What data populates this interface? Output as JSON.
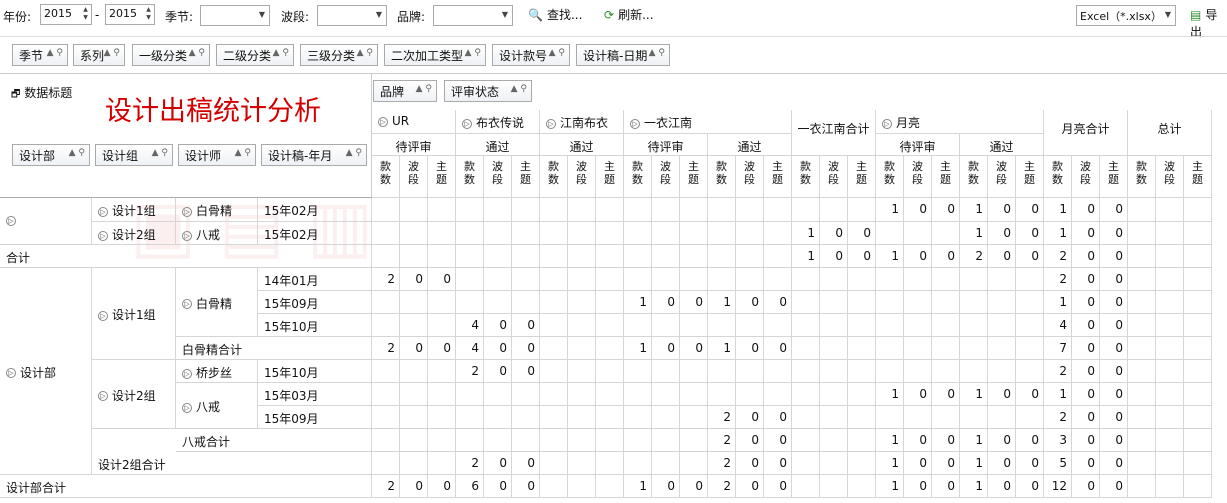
{
  "toolbar": {
    "year_label": "年份:",
    "year_from": "2015",
    "dash": "-",
    "year_to": "2015",
    "season_label": "季节:",
    "band_label": "波段:",
    "brand_label": "品牌:",
    "find_label": "查找...",
    "refresh_label": "刷新...",
    "export_format": "Excel（*.xlsx）",
    "export_label": "导出"
  },
  "fields": [
    "季节",
    "系列",
    "一级分类",
    "二级分类",
    "三级分类",
    "二次加工类型",
    "设计款号",
    "设计稿-日期"
  ],
  "data_title_label": "数据标题",
  "report_title": "设计出稿统计分析",
  "col_fields": [
    "品牌",
    "评审状态"
  ],
  "row_fields": [
    "设计部",
    "设计组",
    "设计师",
    "设计稿-年月"
  ],
  "brands": [
    "UR",
    "布衣传说",
    "江南布衣",
    "一衣江南",
    "一衣江南合计",
    "月亮",
    "月亮合计",
    "总计"
  ],
  "statuses": [
    "待评审",
    "通过",
    "通过",
    "待评审",
    "通过",
    "待评审",
    "通过"
  ],
  "metric": [
    "款数",
    "波段",
    "主题"
  ],
  "rows": [
    {
      "c0": "",
      "c1": "设计1组",
      "c2": "白骨精",
      "c3": "15年02月",
      "v": {
        "18": "1",
        "19": "0",
        "20": "0",
        "21": "1",
        "22": "0",
        "23": "0",
        "24": "1",
        "25": "0",
        "26": "0"
      }
    },
    {
      "c0": "",
      "c1": "设计2组",
      "c2": "八戒",
      "c3": "15年02月",
      "v": {
        "15": "1",
        "16": "0",
        "17": "0",
        "21": "1",
        "22": "0",
        "23": "0",
        "24": "1",
        "25": "0",
        "26": "0"
      }
    },
    {
      "c0": "合计",
      "v": {
        "15": "1",
        "16": "0",
        "17": "0",
        "18": "1",
        "19": "0",
        "20": "0",
        "21": "2",
        "22": "0",
        "23": "0",
        "24": "2",
        "25": "0",
        "26": "0"
      }
    },
    {
      "c3": "14年01月",
      "v": {
        "0": "2",
        "1": "0",
        "2": "0",
        "24": "2",
        "25": "0",
        "26": "0"
      }
    },
    {
      "c3": "15年09月",
      "v": {
        "9": "1",
        "10": "0",
        "11": "0",
        "12": "1",
        "13": "0",
        "14": "0",
        "24": "1",
        "25": "0",
        "26": "0"
      }
    },
    {
      "c3": "15年10月",
      "v": {
        "3": "4",
        "4": "0",
        "5": "0",
        "24": "4",
        "25": "0",
        "26": "0"
      }
    },
    {
      "c2": "白骨精合计",
      "v": {
        "0": "2",
        "1": "0",
        "2": "0",
        "3": "4",
        "4": "0",
        "5": "0",
        "9": "1",
        "10": "0",
        "11": "0",
        "12": "1",
        "13": "0",
        "14": "0",
        "24": "7",
        "25": "0",
        "26": "0"
      }
    },
    {
      "c2": "桥步丝",
      "c3": "15年10月",
      "v": {
        "3": "2",
        "4": "0",
        "5": "0",
        "24": "2",
        "25": "0",
        "26": "0"
      }
    },
    {
      "c3": "15年03月",
      "v": {
        "18": "1",
        "19": "0",
        "20": "0",
        "21": "1",
        "22": "0",
        "23": "0",
        "24": "1",
        "25": "0",
        "26": "0"
      }
    },
    {
      "c3": "15年09月",
      "v": {
        "12": "2",
        "13": "0",
        "14": "0",
        "24": "2",
        "25": "0",
        "26": "0",
        "r": "2"
      }
    },
    {
      "c2": "八戒合计",
      "v": {
        "12": "2",
        "13": "0",
        "14": "0",
        "18": "1",
        "19": "0",
        "20": "0",
        "21": "1",
        "22": "0",
        "23": "0",
        "24": "3",
        "25": "0",
        "26": "0",
        "r": "2"
      }
    },
    {
      "c1": "设计2组合计",
      "v": {
        "3": "2",
        "4": "0",
        "5": "0",
        "12": "2",
        "13": "0",
        "14": "0",
        "18": "1",
        "19": "0",
        "20": "0",
        "21": "1",
        "22": "0",
        "23": "0",
        "24": "5",
        "25": "0",
        "26": "0",
        "r": "2"
      }
    },
    {
      "c0": "设计部合计",
      "v": {
        "0": "2",
        "1": "0",
        "2": "0",
        "3": "6",
        "4": "0",
        "5": "0",
        "9": "1",
        "10": "0",
        "11": "0",
        "12": "2",
        "13": "0",
        "14": "0",
        "18": "1",
        "19": "0",
        "20": "0",
        "21": "1",
        "22": "0",
        "23": "0",
        "24": "12",
        "25": "0",
        "26": "0",
        "r": "3"
      }
    }
  ],
  "labels": {
    "dept": "设计部",
    "g1": "设计1组",
    "g2": "设计2组",
    "bgj": "白骨精",
    "bj": "八戒"
  }
}
